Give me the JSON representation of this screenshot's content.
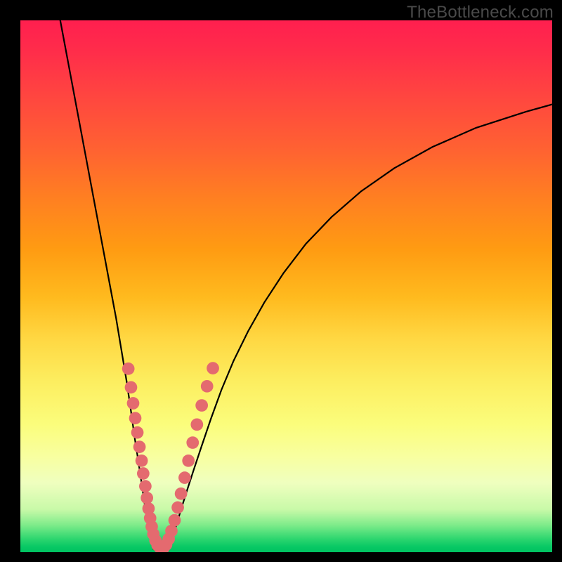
{
  "watermark": "TheBottleneck.com",
  "chart_data": {
    "type": "line",
    "title": "",
    "xlabel": "",
    "ylabel": "",
    "xlim": [
      0,
      100
    ],
    "ylim": [
      0,
      100
    ],
    "series": [
      {
        "name": "left-branch",
        "x": [
          7.5,
          9,
          10.5,
          12,
          13.5,
          15,
          16.5,
          18,
          19,
          20,
          20.8,
          21.5,
          22.2,
          22.8,
          23.3,
          23.8,
          24.2,
          24.6,
          25.0
        ],
        "y": [
          100,
          92,
          84,
          76,
          68,
          60,
          52,
          44,
          38,
          32,
          26.5,
          21.5,
          17,
          13,
          9.5,
          6.5,
          4,
          2,
          0.6
        ]
      },
      {
        "name": "valley",
        "x": [
          25.0,
          25.5,
          26.0,
          26.6,
          27.2,
          27.8
        ],
        "y": [
          0.6,
          0.3,
          0.25,
          0.3,
          0.5,
          0.9
        ]
      },
      {
        "name": "right-branch",
        "x": [
          27.8,
          28.5,
          29.3,
          30.2,
          31.3,
          32.6,
          34.1,
          35.8,
          37.8,
          40.1,
          42.8,
          45.9,
          49.5,
          53.7,
          58.5,
          64.0,
          70.3,
          77.5,
          85.7,
          95.0,
          100.0
        ],
        "y": [
          0.9,
          2.5,
          5,
          8,
          11.5,
          15.5,
          20,
          25,
          30.5,
          36,
          41.5,
          47,
          52.5,
          58,
          63,
          67.8,
          72.2,
          76.2,
          79.8,
          82.8,
          84.2
        ]
      }
    ],
    "markers": {
      "name": "beads",
      "color": "#e46a6f",
      "points": [
        {
          "x": 20.3,
          "y": 34.5,
          "r": 1.3
        },
        {
          "x": 20.8,
          "y": 31.0,
          "r": 1.3
        },
        {
          "x": 21.2,
          "y": 28.0,
          "r": 1.3
        },
        {
          "x": 21.6,
          "y": 25.2,
          "r": 1.3
        },
        {
          "x": 22.0,
          "y": 22.5,
          "r": 1.3
        },
        {
          "x": 22.4,
          "y": 19.8,
          "r": 1.3
        },
        {
          "x": 22.8,
          "y": 17.2,
          "r": 1.3
        },
        {
          "x": 23.1,
          "y": 14.8,
          "r": 1.3
        },
        {
          "x": 23.5,
          "y": 12.4,
          "r": 1.3
        },
        {
          "x": 23.8,
          "y": 10.2,
          "r": 1.3
        },
        {
          "x": 24.1,
          "y": 8.2,
          "r": 1.3
        },
        {
          "x": 24.4,
          "y": 6.4,
          "r": 1.3
        },
        {
          "x": 24.7,
          "y": 4.8,
          "r": 1.3
        },
        {
          "x": 25.0,
          "y": 3.4,
          "r": 1.3
        },
        {
          "x": 25.4,
          "y": 2.2,
          "r": 1.3
        },
        {
          "x": 25.8,
          "y": 1.3,
          "r": 1.3
        },
        {
          "x": 26.3,
          "y": 0.8,
          "r": 1.3
        },
        {
          "x": 26.9,
          "y": 0.8,
          "r": 1.3
        },
        {
          "x": 27.4,
          "y": 1.4,
          "r": 1.3
        },
        {
          "x": 27.9,
          "y": 2.5,
          "r": 1.3
        },
        {
          "x": 28.4,
          "y": 4.0,
          "r": 1.3
        },
        {
          "x": 29.0,
          "y": 6.0,
          "r": 1.3
        },
        {
          "x": 29.6,
          "y": 8.4,
          "r": 1.3
        },
        {
          "x": 30.2,
          "y": 11.0,
          "r": 1.3
        },
        {
          "x": 30.9,
          "y": 14.0,
          "r": 1.3
        },
        {
          "x": 31.6,
          "y": 17.2,
          "r": 1.3
        },
        {
          "x": 32.4,
          "y": 20.6,
          "r": 1.3
        },
        {
          "x": 33.2,
          "y": 24.0,
          "r": 1.3
        },
        {
          "x": 34.1,
          "y": 27.6,
          "r": 1.3
        },
        {
          "x": 35.1,
          "y": 31.2,
          "r": 1.3
        },
        {
          "x": 36.2,
          "y": 34.6,
          "r": 1.3
        }
      ]
    }
  }
}
